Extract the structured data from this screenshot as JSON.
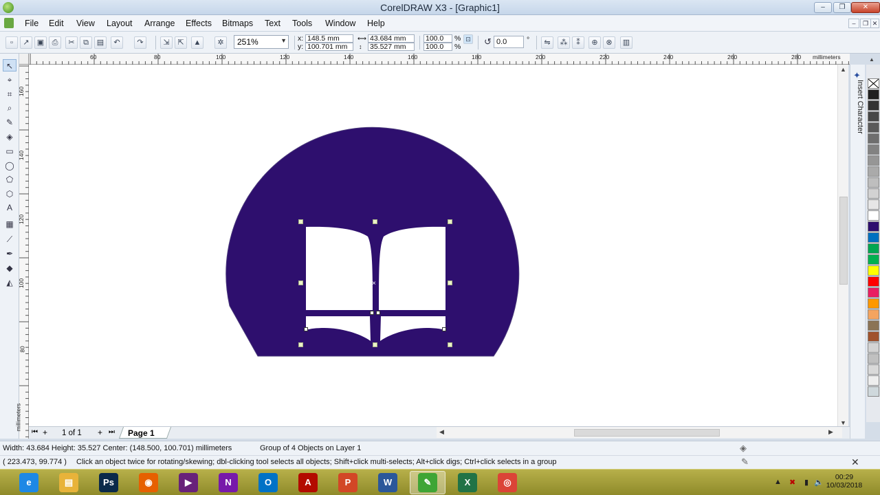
{
  "window": {
    "title": "CorelDRAW X3 - [Graphic1]",
    "min": "–",
    "restore": "❐",
    "close": "✕"
  },
  "menu": [
    "File",
    "Edit",
    "View",
    "Layout",
    "Arrange",
    "Effects",
    "Bitmaps",
    "Text",
    "Tools",
    "Window",
    "Help"
  ],
  "toolbar": {
    "zoom": "251%",
    "x_label": "x:",
    "y_label": "y:",
    "x_value": "148.5 mm",
    "y_value": "100.701 mm",
    "width_value": "43.684 mm",
    "height_value": "35.527 mm",
    "scale_x": "100.0",
    "scale_y": "100.0",
    "percent": "%",
    "angle": "0.0",
    "degree": "°"
  },
  "ruler": {
    "h_ticks": [
      "60",
      "80",
      "100",
      "120",
      "140",
      "160",
      "180",
      "200",
      "220",
      "240",
      "260",
      "280"
    ],
    "unit": "millimeters",
    "v_ticks": [
      "160",
      "140",
      "120",
      "100",
      "80"
    ],
    "v_unit": "millimeters"
  },
  "docker": {
    "label": "Insert Character"
  },
  "palette": {
    "colors": [
      "#202020",
      "#333333",
      "#474747",
      "#5a5a5a",
      "#6e6e6e",
      "#828282",
      "#969696",
      "#aaaaaa",
      "#bebebe",
      "#d2d2d2",
      "#e6e6e6",
      "#ffffff",
      "#2e0f6e",
      "#0070c0",
      "#00a651",
      "#00b050",
      "#ffff00",
      "#ff0000",
      "#e91e63",
      "#ff9800",
      "#f4a460",
      "#8b7355",
      "#a0522d",
      "#d3d3d3",
      "#c0c0c0",
      "#d9d9d9",
      "#eeeeee",
      "#cfd8dc"
    ]
  },
  "pagebar": {
    "page_count": "1 of 1",
    "page_tab": "Page 1"
  },
  "status": {
    "dimensions": "Width: 43.684  Height: 35.527  Center: (148.500, 100.701)  millimeters",
    "selection": "Group of 4 Objects on Layer 1",
    "cursor": "( 223.473, 99.774 )",
    "hint": "Click an object twice for rotating/skewing; dbl-clicking tool selects all objects; Shift+click multi-selects; Alt+click digs; Ctrl+click selects in a group"
  },
  "taskbar": {
    "apps": [
      {
        "name": "ie",
        "label": "e",
        "color": "#1e88e5"
      },
      {
        "name": "explorer",
        "label": "▤",
        "color": "#e8b33a"
      },
      {
        "name": "photoshop",
        "label": "Ps",
        "color": "#0b2a4a"
      },
      {
        "name": "firefox",
        "label": "◉",
        "color": "#e66000"
      },
      {
        "name": "visual-studio",
        "label": "▶",
        "color": "#68217a"
      },
      {
        "name": "onenote",
        "label": "N",
        "color": "#7719aa"
      },
      {
        "name": "outlook",
        "label": "O",
        "color": "#0072c6"
      },
      {
        "name": "acrobat",
        "label": "A",
        "color": "#b30b00"
      },
      {
        "name": "powerpoint",
        "label": "P",
        "color": "#d24726"
      },
      {
        "name": "word",
        "label": "W",
        "color": "#2b579a"
      },
      {
        "name": "coreldraw",
        "label": "✎",
        "color": "#3fa535"
      },
      {
        "name": "excel",
        "label": "X",
        "color": "#217346"
      },
      {
        "name": "chrome",
        "label": "◎",
        "color": "#db4437"
      }
    ],
    "time": "00:29",
    "date": "10/03/2018"
  },
  "artwork": {
    "fill": "#2e0f6e",
    "book": "#ffffff"
  }
}
